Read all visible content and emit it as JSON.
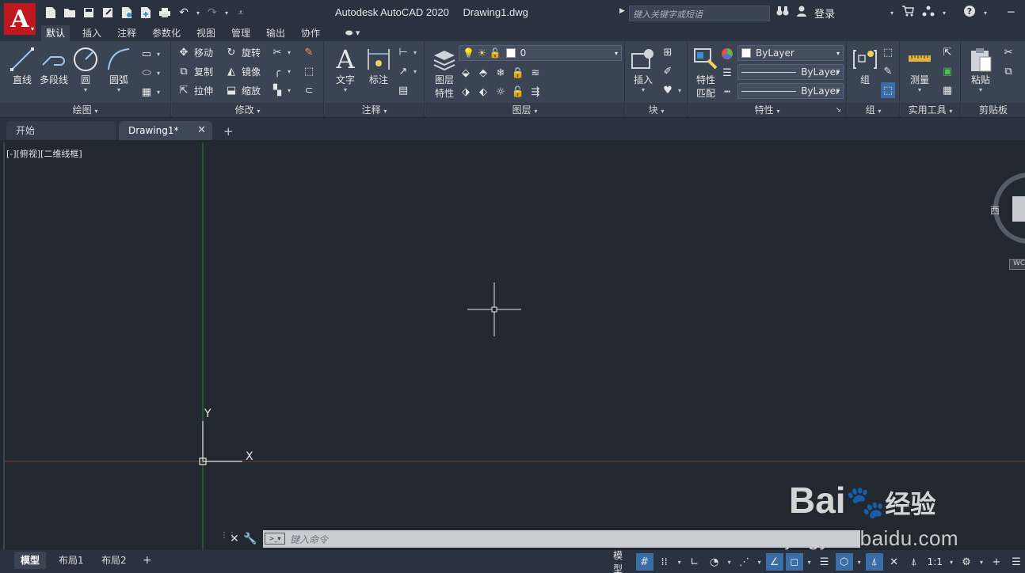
{
  "app": {
    "logo_letter": "A",
    "product": "Autodesk AutoCAD 2020",
    "filename": "Drawing1.dwg",
    "search_placeholder": "键入关键字或短语",
    "login": "登录"
  },
  "ribbon_tabs": [
    "默认",
    "插入",
    "注释",
    "参数化",
    "视图",
    "管理",
    "输出",
    "协作"
  ],
  "panels": {
    "draw": {
      "title": "绘图",
      "line": "直线",
      "polyline": "多段线",
      "circle": "圆",
      "arc": "圆弧"
    },
    "modify": {
      "title": "修改",
      "move": "移动",
      "rotate": "旋转",
      "copy": "复制",
      "mirror": "镜像",
      "stretch": "拉伸",
      "scale": "缩放"
    },
    "annotation": {
      "title": "注释",
      "text": "文字",
      "dimension": "标注"
    },
    "layers": {
      "title": "图层",
      "properties_line1": "图层",
      "properties_line2": "特性",
      "current_layer": "0"
    },
    "block": {
      "title": "块",
      "insert": "插入"
    },
    "properties": {
      "title": "特性",
      "match_line1": "特性",
      "match_line2": "匹配",
      "color": "ByLayer",
      "linetype": "ByLayer",
      "lineweight": "ByLayer"
    },
    "groups": {
      "title": "组",
      "group": "组"
    },
    "utilities": {
      "title": "实用工具",
      "measure": "测量"
    },
    "clipboard": {
      "title": "剪贴板",
      "paste": "粘贴"
    }
  },
  "doc_tabs": {
    "start": "开始",
    "drawing": "Drawing1*"
  },
  "viewport": {
    "label": "[-][俯视][二维线框]",
    "axis_x": "X",
    "axis_y": "Y",
    "viewcube_west": "西",
    "wcs": "WC"
  },
  "command_line": {
    "placeholder": "键入命令"
  },
  "layout_tabs": [
    "模型",
    "布局1",
    "布局2"
  ],
  "status": {
    "model": "模型",
    "scale": "1:1"
  },
  "watermark": {
    "brand": "Bai",
    "brand_suffix": "经验",
    "url": "jingyan.baidu.com"
  },
  "colors": {
    "accent_red": "#c0161d",
    "canvas": "#212830",
    "ribbon": "#3b4453",
    "x_axis": "#a83a3a",
    "y_axis": "#3a8a3a"
  }
}
